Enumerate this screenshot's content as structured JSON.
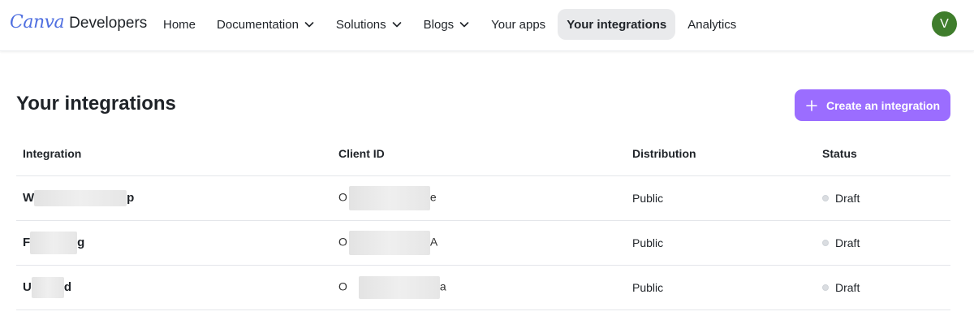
{
  "header": {
    "logo_text": "Canva",
    "product_text": "Developers",
    "nav": [
      {
        "label": "Home",
        "has_chevron": false,
        "active": false
      },
      {
        "label": "Documentation",
        "has_chevron": true,
        "active": false
      },
      {
        "label": "Solutions",
        "has_chevron": true,
        "active": false
      },
      {
        "label": "Blogs",
        "has_chevron": true,
        "active": false
      },
      {
        "label": "Your apps",
        "has_chevron": false,
        "active": false
      },
      {
        "label": "Your integrations",
        "has_chevron": false,
        "active": true
      },
      {
        "label": "Analytics",
        "has_chevron": false,
        "active": false
      }
    ],
    "avatar_initial": "V",
    "avatar_color": "#3f7d2c"
  },
  "page": {
    "title": "Your integrations",
    "create_button_label": "Create an integration",
    "create_button_icon": "plus-icon",
    "accent_color": "#9b6dff"
  },
  "table": {
    "columns": [
      "Integration",
      "Client ID",
      "Distribution",
      "Status"
    ],
    "rows": [
      {
        "name_start": "W",
        "name_end": "p",
        "id_start": "O",
        "id_end": "e",
        "distribution": "Public",
        "status": "Draft"
      },
      {
        "name_start": "F",
        "name_end": "g",
        "id_start": "O",
        "id_end": "A",
        "distribution": "Public",
        "status": "Draft"
      },
      {
        "name_start": "U",
        "name_end": "d",
        "id_start": "O",
        "id_end": "a",
        "distribution": "Public",
        "status": "Draft"
      }
    ]
  }
}
